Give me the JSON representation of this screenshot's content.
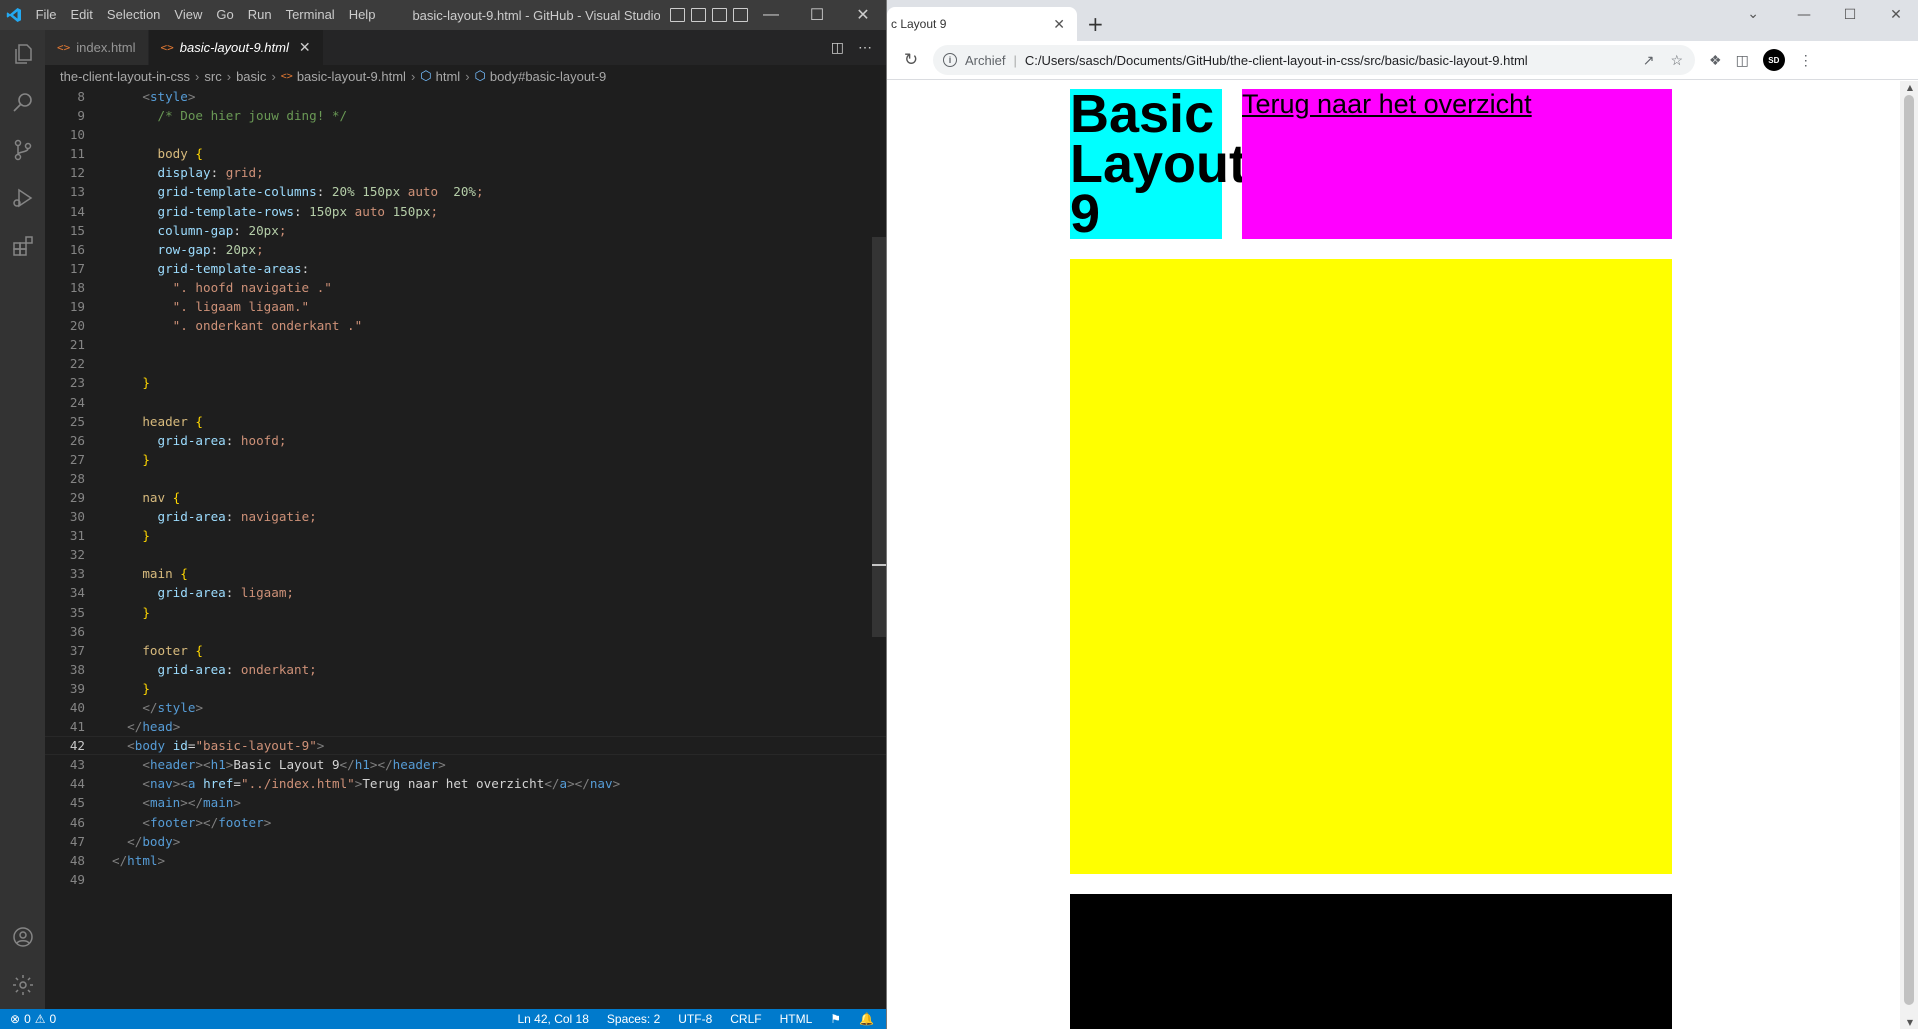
{
  "vscode": {
    "menu": [
      "File",
      "Edit",
      "Selection",
      "View",
      "Go",
      "Run",
      "Terminal",
      "Help"
    ],
    "title": "basic-layout-9.html - GitHub - Visual Studio ...",
    "tabs": [
      {
        "label": "index.html",
        "active": false
      },
      {
        "label": "basic-layout-9.html",
        "active": true
      }
    ],
    "breadcrumbs": [
      "the-client-layout-in-css",
      "src",
      "basic",
      "basic-layout-9.html",
      "html",
      "body#basic-layout-9"
    ],
    "status": {
      "errors": "0",
      "warnings": "0",
      "position": "Ln 42, Col 18",
      "spaces": "Spaces: 2",
      "encoding": "UTF-8",
      "eol": "CRLF",
      "language": "HTML"
    },
    "code_lines": [
      {
        "n": "8",
        "text": "    <style>"
      },
      {
        "n": "9",
        "text": "      /* Doe hier jouw ding! */"
      },
      {
        "n": "10",
        "text": ""
      },
      {
        "n": "11",
        "text": "      body {"
      },
      {
        "n": "12",
        "text": "      display: grid;"
      },
      {
        "n": "13",
        "text": "      grid-template-columns: 20% 150px auto  20%;"
      },
      {
        "n": "14",
        "text": "      grid-template-rows: 150px auto 150px;"
      },
      {
        "n": "15",
        "text": "      column-gap: 20px;"
      },
      {
        "n": "16",
        "text": "      row-gap: 20px;"
      },
      {
        "n": "17",
        "text": "      grid-template-areas:"
      },
      {
        "n": "18",
        "text": "        \". hoofd navigatie .\""
      },
      {
        "n": "19",
        "text": "        \". ligaam ligaam.\""
      },
      {
        "n": "20",
        "text": "        \". onderkant onderkant .\""
      },
      {
        "n": "21",
        "text": ""
      },
      {
        "n": "22",
        "text": ""
      },
      {
        "n": "23",
        "text": "    }"
      },
      {
        "n": "24",
        "text": ""
      },
      {
        "n": "25",
        "text": "    header {"
      },
      {
        "n": "26",
        "text": "      grid-area: hoofd;"
      },
      {
        "n": "27",
        "text": "    }"
      },
      {
        "n": "28",
        "text": ""
      },
      {
        "n": "29",
        "text": "    nav {"
      },
      {
        "n": "30",
        "text": "      grid-area: navigatie;"
      },
      {
        "n": "31",
        "text": "    }"
      },
      {
        "n": "32",
        "text": ""
      },
      {
        "n": "33",
        "text": "    main {"
      },
      {
        "n": "34",
        "text": "      grid-area: ligaam;"
      },
      {
        "n": "35",
        "text": "    }"
      },
      {
        "n": "36",
        "text": ""
      },
      {
        "n": "37",
        "text": "    footer {"
      },
      {
        "n": "38",
        "text": "      grid-area: onderkant;"
      },
      {
        "n": "39",
        "text": "    }"
      },
      {
        "n": "40",
        "text": "    </style>"
      },
      {
        "n": "41",
        "text": "  </head>"
      },
      {
        "n": "42",
        "text": "  <body id=\"basic-layout-9\">"
      },
      {
        "n": "43",
        "text": "    <header><h1>Basic Layout 9</h1></header>"
      },
      {
        "n": "44",
        "text": "    <nav><a href=\"../index.html\">Terug naar het overzicht</a></nav>"
      },
      {
        "n": "45",
        "text": "    <main></main>"
      },
      {
        "n": "46",
        "text": "    <footer></footer>"
      },
      {
        "n": "47",
        "text": "  </body>"
      },
      {
        "n": "48",
        "text": "</html>"
      },
      {
        "n": "49",
        "text": ""
      }
    ],
    "current_line": "42"
  },
  "chrome": {
    "tab_title": "c Layout 9",
    "security_label": "Archief",
    "url": "C:/Users/sasch/Documents/GitHub/the-client-layout-in-css/src/basic/basic-layout-9.html",
    "avatar_text": "SD",
    "page": {
      "h1": "Basic Layout 9",
      "nav_link": "Terug naar het overzicht",
      "colors": {
        "header": "#00ffff",
        "nav": "#ff00ff",
        "main": "#ffff00",
        "footer": "#000000"
      }
    }
  }
}
